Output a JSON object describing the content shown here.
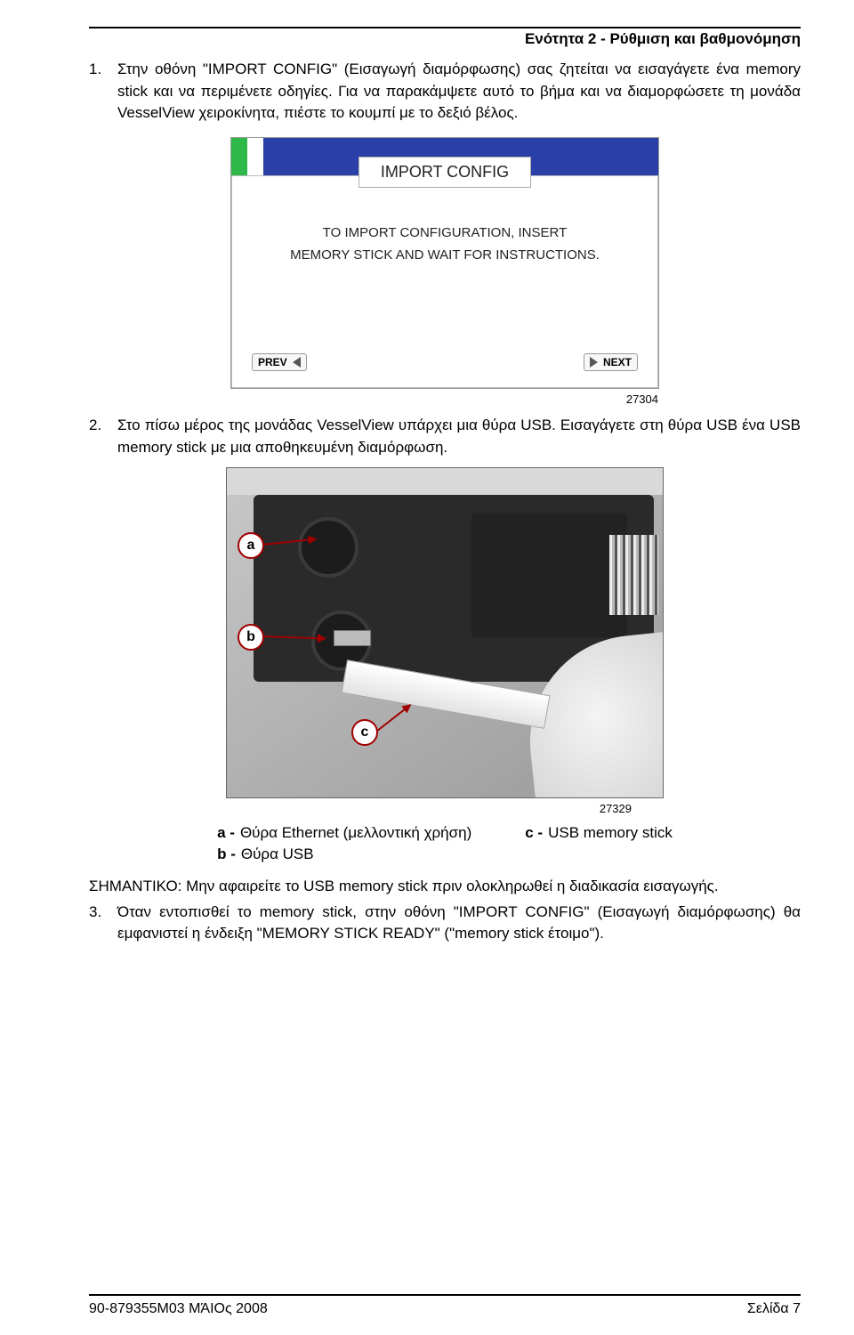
{
  "header": {
    "section_title": "Ενότητα 2 - Ρύθμιση και βαθμονόμηση"
  },
  "steps": {
    "s1": {
      "num": "1.",
      "text": "Στην οθόνη \"IMPORT CONFIG\" (Εισαγωγή διαμόρφωσης) σας ζητείται να εισαγάγετε ένα memory stick και να περιμένετε οδηγίες. Για να παρακάμψετε αυτό το βήμα και να διαμορφώσετε τη μονάδα VesselView χειροκίνητα, πιέστε το κουμπί με το δεξιό βέλος."
    },
    "s2": {
      "num": "2.",
      "text": "Στο πίσω μέρος της μονάδας VesselView υπάρχει μια θύρα USB. Εισαγάγετε στη θύρα USB ένα USB memory stick με μια αποθηκευμένη διαμόρφωση."
    },
    "s3": {
      "num": "3.",
      "text": "Όταν εντοπισθεί το memory stick, στην οθόνη \"IMPORT CONFIG\" (Εισαγωγή διαμόρφωσης) θα εμφανιστεί η ένδειξη \"MEMORY STICK READY\" (\"memory stick έτοιμο\")."
    }
  },
  "figure1": {
    "title": "IMPORT CONFIG",
    "body_line1": "TO IMPORT CONFIGURATION, INSERT",
    "body_line2": "MEMORY STICK AND WAIT FOR INSTRUCTIONS.",
    "prev": "PREV",
    "next": "NEXT",
    "caption": "27304"
  },
  "figure2": {
    "callout_a": "a",
    "callout_b": "b",
    "callout_c": "c",
    "caption": "27329",
    "legend": {
      "a_key": "a -",
      "a_text": "Θύρα Ethernet (μελλοντική χρήση)",
      "b_key": "b -",
      "b_text": "Θύρα USB",
      "c_key": "c -",
      "c_text": "USB memory stick"
    }
  },
  "notice": {
    "label": "ΣΗΜΑΝΤΙΚΟ:",
    "text": "Μην αφαιρείτε το USB memory stick πριν ολοκληρωθεί η διαδικασία εισαγωγής."
  },
  "footer": {
    "left": "90-879355M03   ΜΆΙΟς  2008",
    "right": "Σελίδα   7"
  }
}
